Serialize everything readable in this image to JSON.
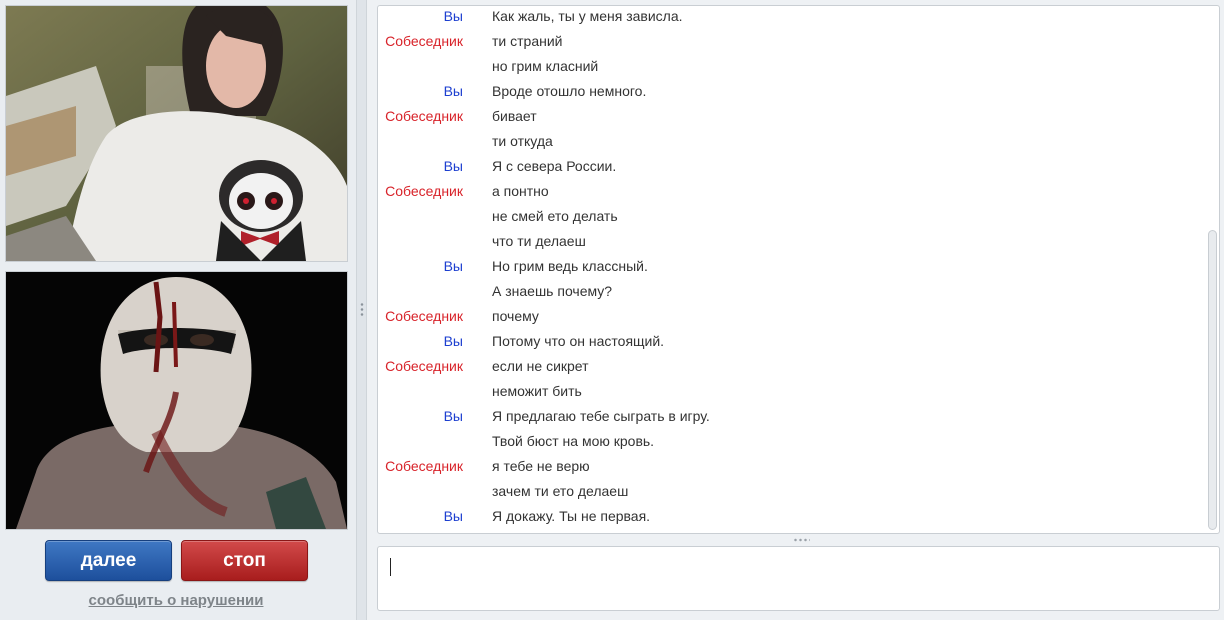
{
  "buttons": {
    "next": "далее",
    "stop": "стоп",
    "report": "сообщить о нарушении"
  },
  "colors": {
    "you": "#1d3fd0",
    "stranger": "#d8232a",
    "next_button": "#2b5faf",
    "stop_button": "#c12a2a"
  },
  "chat": {
    "messages": [
      {
        "sender": "Вы",
        "role": "you",
        "text": "Как жаль, ты у меня зависла."
      },
      {
        "sender": "Собеседник",
        "role": "stranger",
        "text": "ти страний"
      },
      {
        "sender": "",
        "role": "stranger",
        "text": "но грим класний"
      },
      {
        "sender": "Вы",
        "role": "you",
        "text": "Вроде отошло немного."
      },
      {
        "sender": "Собеседник",
        "role": "stranger",
        "text": "бивает"
      },
      {
        "sender": "",
        "role": "stranger",
        "text": "ти откуда"
      },
      {
        "sender": "Вы",
        "role": "you",
        "text": "Я с севера России."
      },
      {
        "sender": "Собеседник",
        "role": "stranger",
        "text": "а понтно"
      },
      {
        "sender": "",
        "role": "stranger",
        "text": "не смей ето делать"
      },
      {
        "sender": "",
        "role": "stranger",
        "text": "что ти делаеш"
      },
      {
        "sender": "Вы",
        "role": "you",
        "text": "Но грим ведь классный."
      },
      {
        "sender": "",
        "role": "you",
        "text": "А знаешь почему?"
      },
      {
        "sender": "Собеседник",
        "role": "stranger",
        "text": "почему"
      },
      {
        "sender": "Вы",
        "role": "you",
        "text": "Потому что он настоящий."
      },
      {
        "sender": "Собеседник",
        "role": "stranger",
        "text": "если не сикрет"
      },
      {
        "sender": "",
        "role": "stranger",
        "text": "неможит бить"
      },
      {
        "sender": "Вы",
        "role": "you",
        "text": "Я предлагаю тебе сыграть в игру."
      },
      {
        "sender": "",
        "role": "you",
        "text": "Твой бюст на мою кровь."
      },
      {
        "sender": "Собеседник",
        "role": "stranger",
        "text": "я тебе не верю"
      },
      {
        "sender": "",
        "role": "stranger",
        "text": "зачем ти ето делаеш"
      },
      {
        "sender": "Вы",
        "role": "you",
        "text": "Я докажу. Ты не первая."
      }
    ]
  },
  "input": {
    "value": ""
  }
}
